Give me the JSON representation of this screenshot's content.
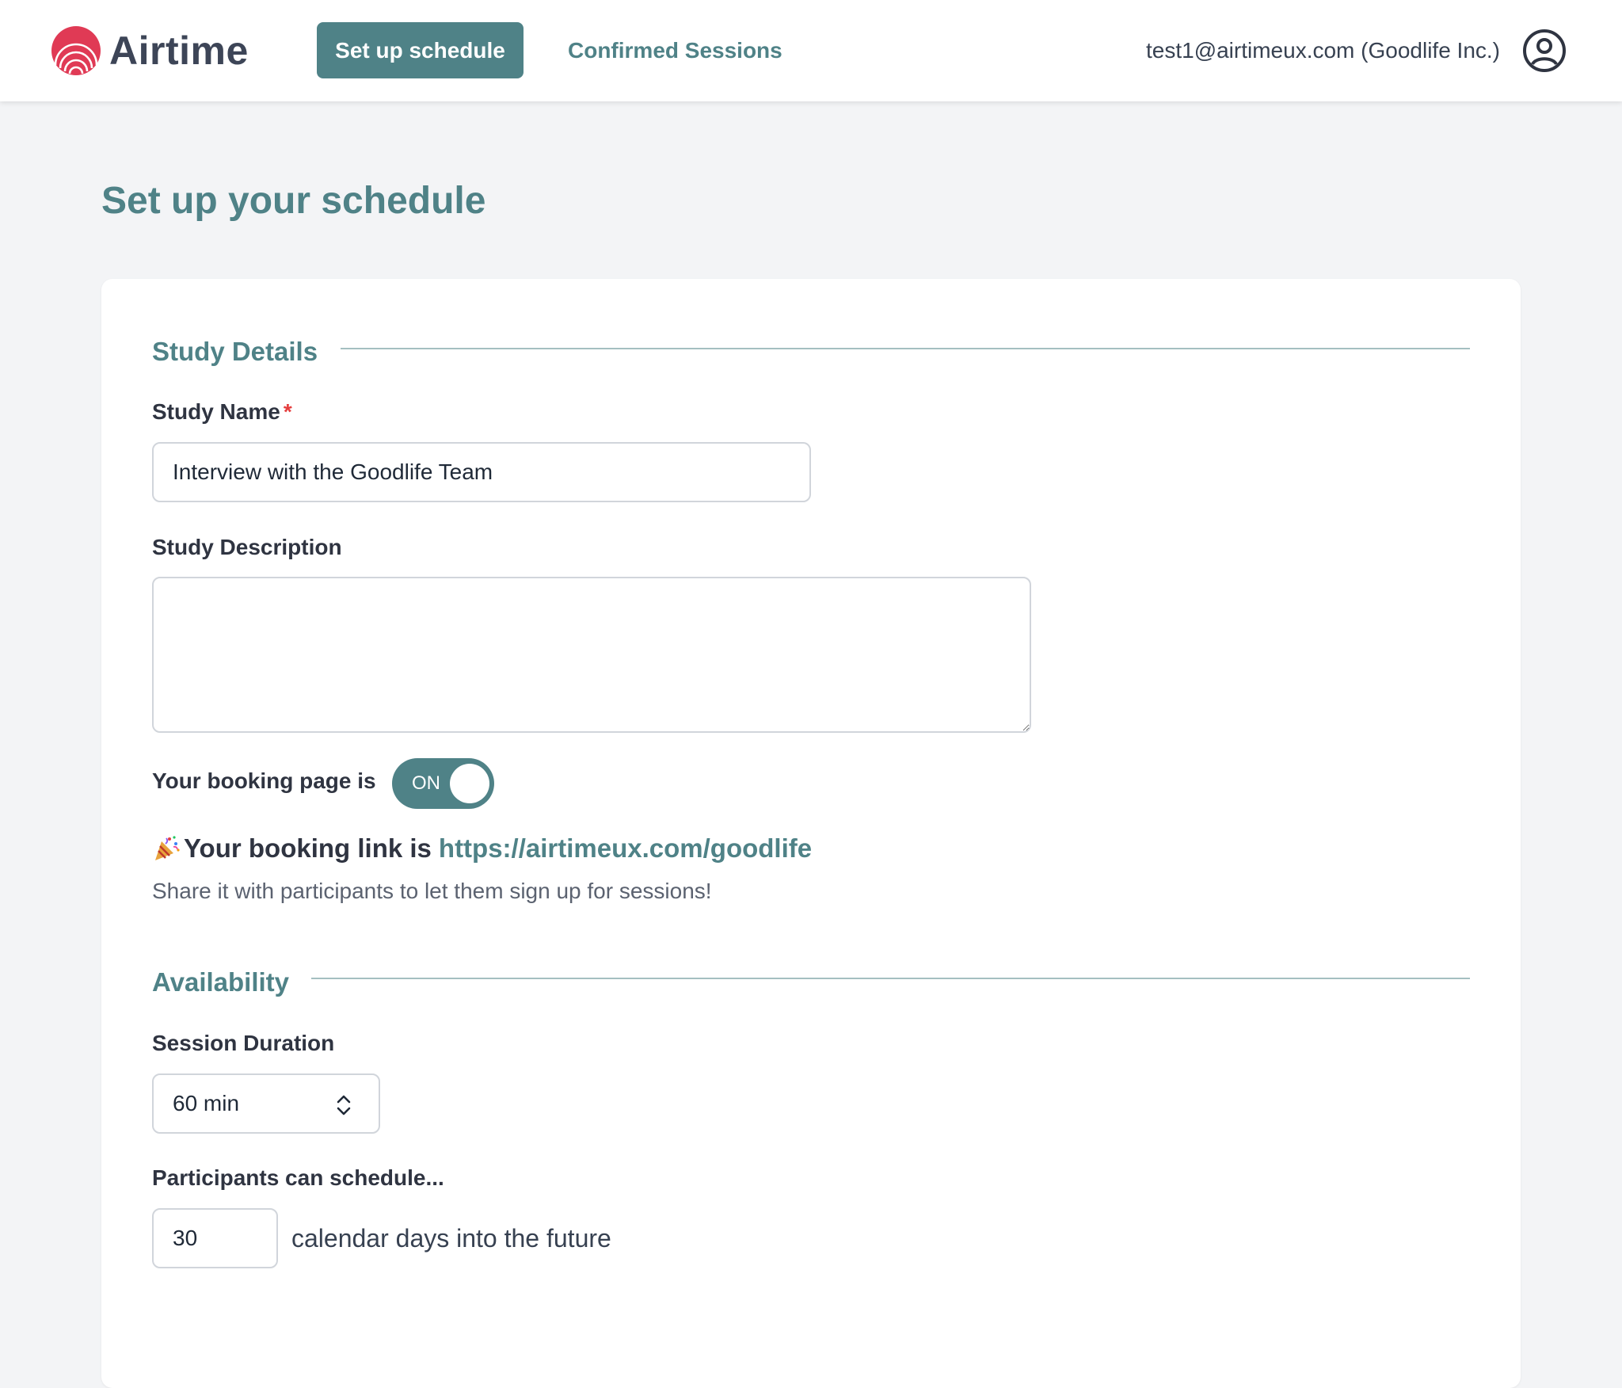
{
  "header": {
    "logo_text": "Airtime",
    "nav": {
      "setup_label": "Set up schedule",
      "sessions_label": "Confirmed Sessions"
    },
    "user_label": "test1@airtimeux.com (Goodlife Inc.)",
    "avatar_icon": "user-circle-icon"
  },
  "page": {
    "title": "Set up your schedule"
  },
  "study_details": {
    "section_title": "Study Details",
    "name_label": "Study Name",
    "required_mark": "*",
    "name_value": "Interview with the Goodlife Team",
    "description_label": "Study Description",
    "description_value": "",
    "booking_toggle_label": "Your booking page is",
    "booking_toggle_state": "ON",
    "booking_link_prefix": "Your booking link is",
    "booking_link_url": "https://airtimeux.com/goodlife",
    "booking_link_icon": "party-popper-icon",
    "share_text": "Share it with participants to let them sign up for sessions!"
  },
  "availability": {
    "section_title": "Availability",
    "duration_label": "Session Duration",
    "duration_value": "60 min",
    "schedule_label": "Participants can schedule...",
    "days_value": "30",
    "days_suffix": "calendar days into the future"
  },
  "colors": {
    "accent": "#4f8287",
    "logo": "#e03a55",
    "background": "#f3f4f6"
  }
}
